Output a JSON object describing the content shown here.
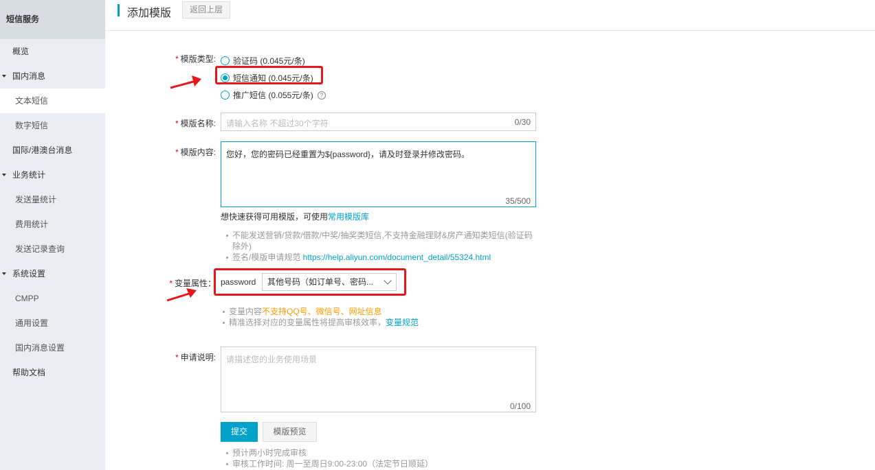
{
  "sidebar": {
    "title": "短信服务",
    "items": [
      {
        "label": "概览"
      },
      {
        "label": "国内消息"
      },
      {
        "label": "文本短信"
      },
      {
        "label": "数字短信"
      },
      {
        "label": "国际/港澳台消息"
      },
      {
        "label": "业务统计"
      },
      {
        "label": "发送量统计"
      },
      {
        "label": "费用统计"
      },
      {
        "label": "发送记录查询"
      },
      {
        "label": "系统设置"
      },
      {
        "label": "CMPP"
      },
      {
        "label": "通用设置"
      },
      {
        "label": "国内消息设置"
      },
      {
        "label": "帮助文档"
      }
    ]
  },
  "header": {
    "title": "添加模版",
    "back_label": "返回上层"
  },
  "form": {
    "type": {
      "label": "模版类型:",
      "options": [
        {
          "label": "验证码 (0.045元/条)",
          "checked": false
        },
        {
          "label": "短信通知 (0.045元/条)",
          "checked": true
        },
        {
          "label": "推广短信 (0.055元/条)",
          "checked": false
        }
      ],
      "help": "?"
    },
    "name": {
      "label": "模版名称:",
      "placeholder": "请输入名称 不超过30个字符",
      "counter": "0/30"
    },
    "content": {
      "label": "模版内容:",
      "value": "您好，您的密码已经重置为${password}，请及时登录并修改密码。",
      "counter": "35/500",
      "quick_tip": "想快速获得可用模版，可使用",
      "quick_link": "常用模版库",
      "hints": [
        "不能发送营销/贷款/借款/中奖/抽奖类短信,不支持金融理财&房产通知类短信(验证码除外)",
        "签名/模版申请规范 "
      ],
      "hint_link": "https://help.aliyun.com/document_detail/55324.html"
    },
    "variable": {
      "label": "变量属性：",
      "name": "password",
      "selected": "其他号码（如订单号、密码...",
      "hint1_prefix": "变量内容",
      "hint1_warn": "不支持QQ号、微信号、网址信息",
      "hint2_prefix": "精准选择对应的变量属性将提高审核效率，",
      "hint2_link": "变量规范"
    },
    "remark": {
      "label": "申请说明:",
      "placeholder": "请描述您的业务使用场景",
      "counter": "0/100"
    },
    "submit_label": "提交",
    "preview_label": "模版预览",
    "footer_hints": [
      "预计两小时完成审核",
      "审核工作时间: 周一至周日9:00-23:00（法定节日顺延）"
    ]
  },
  "colors": {
    "accent": "#00a2ca",
    "annotation_red": "#e8161d",
    "warning": "#ff9900"
  }
}
